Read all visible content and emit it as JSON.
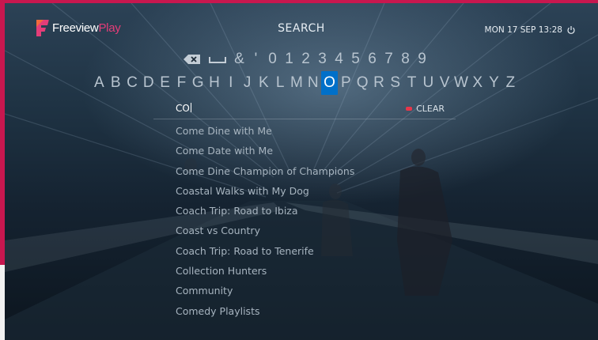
{
  "brand": {
    "name_main": "Freeview",
    "name_accent": "Play"
  },
  "header": {
    "title": "SEARCH",
    "datetime": "MON 17 SEP 13:28"
  },
  "keyboard": {
    "row1": [
      "&",
      "'",
      "0",
      "1",
      "2",
      "3",
      "4",
      "5",
      "6",
      "7",
      "8",
      "9"
    ],
    "row2": [
      "A",
      "B",
      "C",
      "D",
      "E",
      "F",
      "G",
      "H",
      "I",
      "J",
      "K",
      "L",
      "M",
      "N",
      "O",
      "P",
      "Q",
      "R",
      "S",
      "T",
      "U",
      "V",
      "W",
      "X",
      "Y",
      "Z"
    ],
    "selected_key": "O"
  },
  "search": {
    "query": "CO",
    "clear_label": "CLEAR"
  },
  "results": [
    "Come Dine with Me",
    "Come Date with Me",
    "Come Dine Champion of Champions",
    "Coastal Walks with My Dog",
    "Coach Trip: Road to Ibiza",
    "Coast vs Country",
    "Coach Trip: Road to Tenerife",
    "Collection Hunters",
    "Community",
    "Comedy Playlists"
  ],
  "colors": {
    "accent": "#0070c9",
    "brand_pink": "#e43d78",
    "frame": "#c8174f",
    "clear_dot": "#e8364a"
  }
}
